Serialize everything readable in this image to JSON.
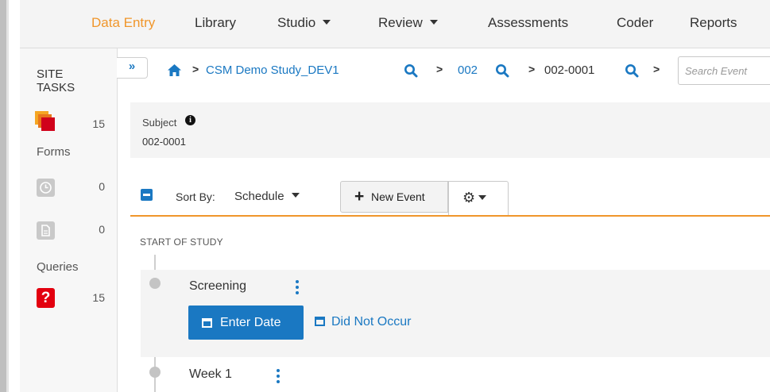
{
  "topnav": {
    "items": [
      {
        "label": "Data Entry",
        "active": true
      },
      {
        "label": "Library"
      },
      {
        "label": "Studio",
        "dropdown": true
      },
      {
        "label": "Review",
        "dropdown": true
      },
      {
        "label": "Assessments"
      },
      {
        "label": "Coder"
      },
      {
        "label": "Reports"
      }
    ]
  },
  "sidebar": {
    "title": "SITE TASKS",
    "tasks_count": "15",
    "forms_label": "Forms",
    "forms": [
      {
        "icon": "clock-icon",
        "count": "0"
      },
      {
        "icon": "document-icon",
        "count": "0"
      }
    ],
    "queries_label": "Queries",
    "queries_count": "15"
  },
  "breadcrumb": {
    "collapse": "»",
    "study": "CSM Demo Study_DEV1",
    "site": "002",
    "subject": "002-0001",
    "search_placeholder": "Search Event"
  },
  "subject_panel": {
    "label": "Subject",
    "value": "002-0001"
  },
  "toolbar": {
    "sort_label": "Sort By:",
    "sort_value": "Schedule",
    "new_event_label": "New Event"
  },
  "timeline": {
    "start_label": "START OF STUDY",
    "events": [
      {
        "name": "Screening",
        "enter_date_label": "Enter Date",
        "did_not_occur_label": "Did Not Occur"
      },
      {
        "name": "Week 1"
      }
    ]
  },
  "colors": {
    "accent_orange": "#f0962b",
    "primary_blue": "#1a78c2",
    "query_red": "#e3000f"
  }
}
